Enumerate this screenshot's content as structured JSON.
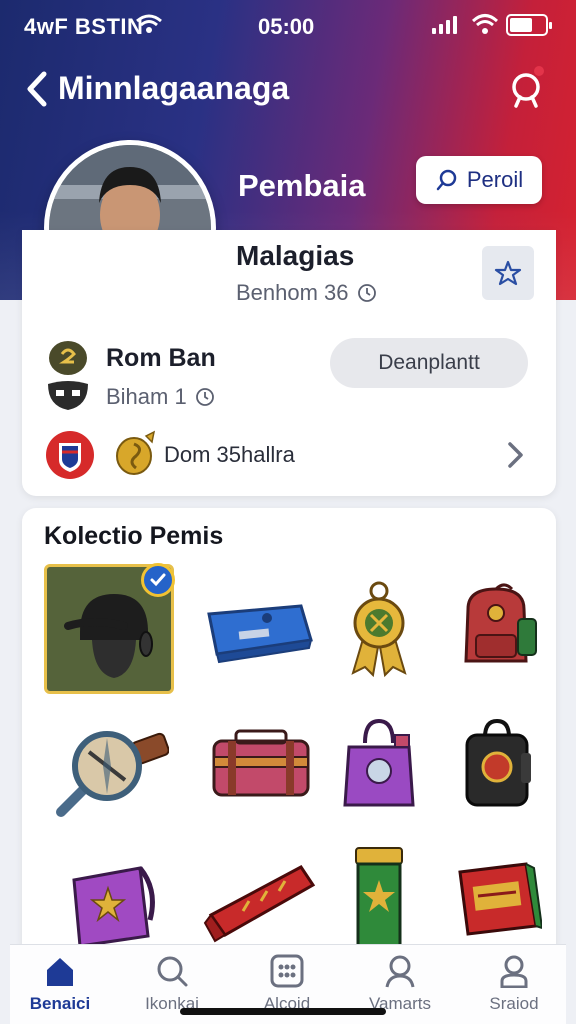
{
  "status_bar": {
    "carrier": "4wF BSTIN",
    "time": "05:00"
  },
  "nav": {
    "title": "Minnlagaanaga",
    "back_icon": "chevron-left-icon",
    "search_icon": "search-icon"
  },
  "hero": {
    "name": "Pembaia",
    "profile_button": "Peroil"
  },
  "player": {
    "name": "Malagias",
    "subtitle": "Benhom 36"
  },
  "club": {
    "name": "Rom Ban",
    "subtitle": "Biham 1",
    "action_button": "Deanplantt"
  },
  "stats": {
    "text": "Dom 35hallra"
  },
  "collection": {
    "title": "Kolectio Pemis",
    "items": [
      "helmet",
      "toolbox",
      "medal",
      "backpack-red",
      "compass-sword",
      "trunk",
      "bag-purple",
      "backpack-black",
      "bag-purple-star",
      "scarf",
      "banner-green",
      "book-red"
    ]
  },
  "tabs": [
    {
      "label": "Benaici",
      "icon": "home-icon",
      "active": true
    },
    {
      "label": "Ikonkai",
      "icon": "search-icon",
      "active": false
    },
    {
      "label": "Alcoid",
      "icon": "grid-icon",
      "active": false
    },
    {
      "label": "Vamarts",
      "icon": "user-icon",
      "active": false
    },
    {
      "label": "Sraiod",
      "icon": "person-icon",
      "active": false
    }
  ],
  "colors": {
    "brand_blue": "#1e3a96",
    "brand_red": "#d6222f",
    "gold": "#e7c04a"
  }
}
